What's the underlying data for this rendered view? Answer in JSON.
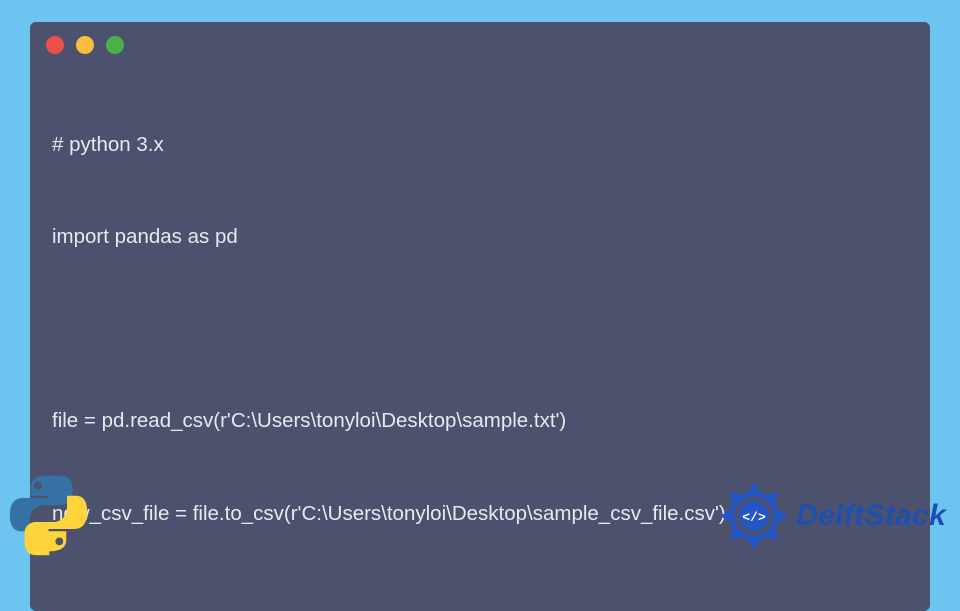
{
  "code": {
    "lines": [
      "# python 3.x",
      "import pandas as pd",
      "",
      "file = pd.read_csv(r'C:\\Users\\tonyloi\\Desktop\\sample.txt')",
      "new_csv_file = file.to_csv(r'C:\\Users\\tonyloi\\Desktop\\sample_csv_file.csv')"
    ]
  },
  "window": {
    "dot_red": "#ec5049",
    "dot_yellow": "#f8be3d",
    "dot_green": "#49b14c"
  },
  "brand": {
    "name": "DelftStack"
  }
}
